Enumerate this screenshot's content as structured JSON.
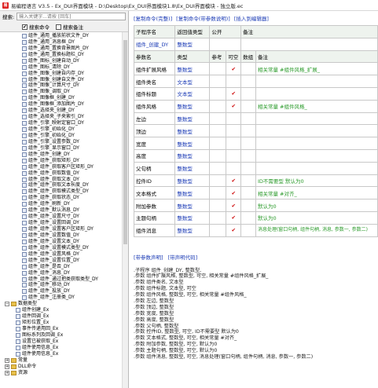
{
  "window": {
    "title": "易编程语言 V3.5 - Ex_DUI界面模块 - D:\\Desktop\\Ex_DUI界面模块1.8\\Ex_DUI界面模块 - 独立版.ec"
  },
  "search": {
    "label": "搜索:",
    "placeholder": "输入关键字...请按 [回车]"
  },
  "checks": {
    "search_cmd": "搜索命令",
    "search_comment": "搜索备注"
  },
  "tree": {
    "items": [
      "组件_通用_播放前状文件_DY",
      "组件_通用_消息框_DY",
      "组件_通用_置换背景图片_DY",
      "组件_通用_置换标题栏_DY",
      "组件_图标_创建自动_DY",
      "组件_图标_清除_DY",
      "组件_图像_创建自内存_DY",
      "组件_图像_创建自文件_DY",
      "组件_图像_计算尺寸_DY",
      "组件_图像_调取_DY",
      "组件_图像框_创建_DY",
      "组件_图像框_添加图片_DY",
      "组件_选择夹_创建_DY",
      "组件_选择夹_子夹索引_DY",
      "组件_引擎_映射定窗口_DY",
      "组件_引擎_初始化_DY",
      "组件_引擎_初始化_DY",
      "组件_引擎_设置参数_DY",
      "组件_引擎_显示窗口_DY",
      "组件_组件_创建_DY",
      "组件_组件_获取矩形_DY",
      "组件_组件_获取客户区矩形_DY",
      "组件_组件_获取数值_DY",
      "组件_组件_获取文本_DY",
      "组件_组件_获取文本长度_DY",
      "组件_组件_获取模式类型_DY",
      "组件_组件_获取状态_DY",
      "组件_组件_刷新_DY",
      "组件_组件_默认消息_DY",
      "组件_组件_设置尺寸_DY",
      "组件_组件_设置回调_DY",
      "组件_组件_设置客户区矩形_DY",
      "组件_组件_设置数值_DY",
      "组件_组件_设置文本_DY",
      "组件_组件_设置模式类型_DY",
      "组件_组件_设置风格_DY",
      "组件_组件_设置位置_DY",
      "组件_组件_是否_DY",
      "组件_组件_消息_DY",
      "组件_组件_通过把类获取类型_DY",
      "组件_组件_移动_DY",
      "组件_组件_投放_DY",
      "组件_组件_注册类_DY"
    ],
    "group1": "数据类型",
    "group1_items": [
      "组件创建_Ex",
      "组件回调_Ex",
      "矩形位置_Ex",
      "事件传递用回_Ex",
      "图标系列及回调_Ex",
      "设置已被获取_Ex",
      "组件使用信息_Ex",
      "组件使用信息_Ex"
    ],
    "group2": "常量",
    "group3": "DLL命令",
    "group4": "资源"
  },
  "tabs_top": [
    "[复制命令(完整)]",
    "[复制命令(带参数说明)]",
    "[插入到编辑器]"
  ],
  "table": {
    "h1": [
      "子程序名",
      "返回值类型",
      "公开",
      "备注"
    ],
    "sub_name": "组件_创建_DY",
    "sub_type": "整数型",
    "h2": [
      "参数名",
      "类型",
      "参考",
      "可空",
      "数组",
      "备注"
    ],
    "params": [
      {
        "name": "组件扩展风格",
        "type": "整数型",
        "nullable": "✔",
        "note": "相关常量 #组件风格_扩展_"
      },
      {
        "name": "组件类名",
        "type": "文本型",
        "nullable": "",
        "note": ""
      },
      {
        "name": "组件标题",
        "type": "文本型",
        "nullable": "✔",
        "note": ""
      },
      {
        "name": "组件风格",
        "type": "整数型",
        "nullable": "✔",
        "note": "相关常量 #组件风格_"
      },
      {
        "name": "左边",
        "type": "整数型",
        "nullable": "",
        "note": ""
      },
      {
        "name": "顶边",
        "type": "整数型",
        "nullable": "",
        "note": ""
      },
      {
        "name": "宽度",
        "type": "整数型",
        "nullable": "",
        "note": ""
      },
      {
        "name": "高度",
        "type": "整数型",
        "nullable": "",
        "note": ""
      },
      {
        "name": "父句柄",
        "type": "整数型",
        "nullable": "",
        "note": ""
      },
      {
        "name": "控件ID",
        "type": "整数型",
        "nullable": "✔",
        "note": "ID不需要型 默认为0"
      },
      {
        "name": "文本格式",
        "type": "整数型",
        "nullable": "✔",
        "note": "相关常量 #对齐_"
      },
      {
        "name": "附加参数",
        "type": "整数型",
        "nullable": "✔",
        "note": "默认为0"
      },
      {
        "name": "主题句柄",
        "type": "整数型",
        "nullable": "✔",
        "note": "默认为0"
      },
      {
        "name": "组件消息",
        "type": "整数型",
        "nullable": "✔",
        "note": "消息处理(窗口句柄, 组件句柄, 消息, 参数一, 参数二)"
      }
    ]
  },
  "tabs_bottom": [
    "[带参数声明]",
    "[带声明代码]"
  ],
  "code": [
    ".子程序 组件_创建_DY, 整数型, ",
    ".参数 组件扩展风格, 整数型, 可空, 相关常量 #组件风格_扩展_",
    ".参数 组件类名, 文本型",
    ".参数 组件标题, 文本型, 可空",
    ".参数 组件风格, 整数型, 可空, 相关常量 #组件风格_",
    ".参数 左边, 整数型",
    ".参数 顶边, 整数型",
    ".参数 宽度, 整数型",
    ".参数 高度, 整数型",
    ".参数 父句柄, 整数型",
    ".参数 控件ID, 整数型, 可空, ID不需要型 默认为0",
    ".参数 文本格式, 整数型, 可空, 相关常量 #对齐_",
    ".参数 附加参数, 整数型, 可空, 默认为0",
    ".参数 主题句柄, 整数型, 可空, 默认为0",
    ".参数 组件消息, 整数型, 可空, 消息处理(窗口句柄, 组件句柄, 消息, 参数一, 参数二)"
  ]
}
